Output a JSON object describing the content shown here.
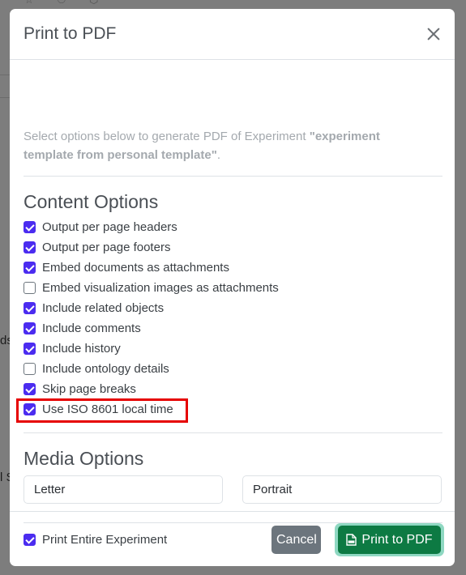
{
  "dialog": {
    "title": "Print to PDF",
    "intro_prefix": "Select options below to generate PDF of Experiment ",
    "intro_name": "\"experiment template from personal template\"",
    "intro_suffix": "."
  },
  "content_options": {
    "title": "Content Options",
    "items": [
      {
        "label": "Output per page headers",
        "checked": true
      },
      {
        "label": "Output per page footers",
        "checked": true
      },
      {
        "label": "Embed documents as attachments",
        "checked": true
      },
      {
        "label": "Embed visualization images as attachments",
        "checked": false
      },
      {
        "label": "Include related objects",
        "checked": true
      },
      {
        "label": "Include comments",
        "checked": true
      },
      {
        "label": "Include history",
        "checked": true
      },
      {
        "label": "Include ontology details",
        "checked": false
      },
      {
        "label": "Skip page breaks",
        "checked": true
      },
      {
        "label": "Use ISO 8601 local time",
        "checked": true
      }
    ]
  },
  "media_options": {
    "title": "Media Options",
    "paper_size": "Letter",
    "orientation": "Portrait"
  },
  "print_entire": {
    "label": "Print Entire Experiment",
    "checked": true
  },
  "footer": {
    "cancel_label": "Cancel",
    "print_label": "Print to PDF"
  },
  "background": {
    "fragment_1": "ds",
    "fragment_2": "l S"
  },
  "colors": {
    "checkbox_accent": "#4b2cf0",
    "primary_button": "#0d7a43",
    "secondary_button": "#6c757d",
    "highlight_border": "#e60000"
  },
  "icons": [
    "close-icon",
    "file-pdf-icon"
  ]
}
